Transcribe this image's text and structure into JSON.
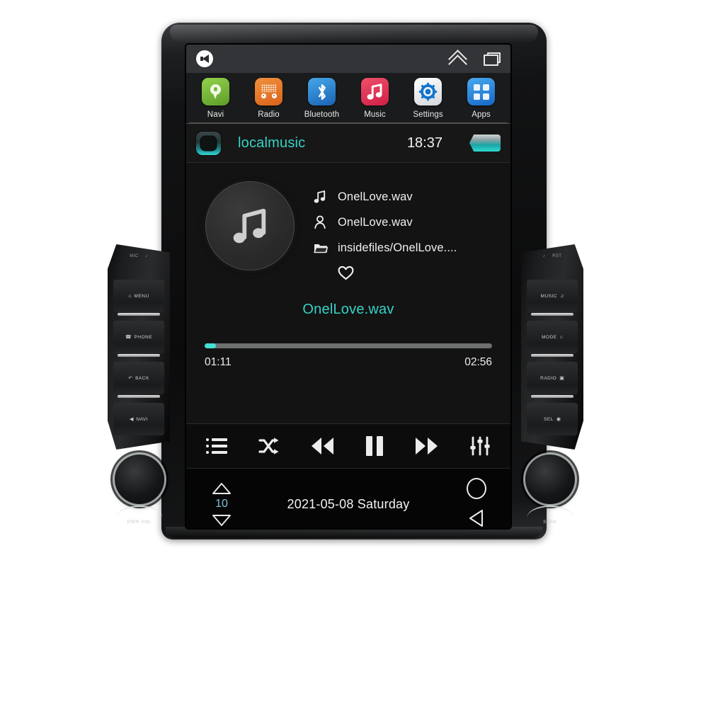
{
  "statusbar": {
    "speaker_icon": "speaker-icon",
    "expand_icon": "double-chevron-up-icon",
    "recents_icon": "recent-apps-icon"
  },
  "apps": [
    {
      "label": "Navi",
      "icon": "map-pin-icon",
      "color": "#7ec142"
    },
    {
      "label": "Radio",
      "icon": "radio-icon",
      "color": "#e5761f"
    },
    {
      "label": "Bluetooth",
      "icon": "bluetooth-icon",
      "color": "#2a86d8"
    },
    {
      "label": "Music",
      "icon": "music-note-icon",
      "color": "#e03256"
    },
    {
      "label": "Settings",
      "icon": "gear-icon",
      "color": "#ffffff"
    },
    {
      "label": "Apps",
      "icon": "grid-apps-icon",
      "color": "#2b86dd"
    }
  ],
  "titlebar": {
    "app_name": "localmusic",
    "time": "18:37",
    "left_icon": "rounded-square-icon",
    "right_icon": "battery-pill-icon",
    "accent": "#35d3c6"
  },
  "player": {
    "album_art_icon": "music-note-icon",
    "track_title": "OnelLove.wav",
    "artist": "OnelLove.wav",
    "folder": "insidefiles/OnelLove....",
    "favorite_icon": "heart-outline-icon",
    "now_playing": "OnelLove.wav",
    "elapsed": "01:11",
    "duration": "02:56",
    "progress_percent": 4,
    "progress_fill_color": "#45e0d4"
  },
  "controls": [
    {
      "name": "playlist-button",
      "icon": "list-icon"
    },
    {
      "name": "shuffle-button",
      "icon": "shuffle-icon"
    },
    {
      "name": "previous-button",
      "icon": "previous-track-icon"
    },
    {
      "name": "pause-button",
      "icon": "pause-icon"
    },
    {
      "name": "next-button",
      "icon": "next-track-icon"
    },
    {
      "name": "equalizer-button",
      "icon": "equalizer-icon"
    }
  ],
  "bottombar": {
    "volume_up_icon": "triangle-up-icon",
    "volume_level": "10",
    "volume_down_icon": "triangle-down-icon",
    "date": "2021-05-08  Saturday",
    "home_icon": "home-circle-icon",
    "back_icon": "back-triangle-icon",
    "volume_color": "#7fc3d8"
  },
  "hardware": {
    "left_panel": {
      "top_label_a": "MIC",
      "top_label_b": "♪",
      "buttons": [
        {
          "label": "MENU",
          "glyph": "⌂"
        },
        {
          "label": "PHONE",
          "glyph": "☎"
        },
        {
          "label": "BACK",
          "glyph": "↶"
        },
        {
          "label": "NAVI",
          "glyph": "◀"
        }
      ],
      "knob_label": "PWR VOL"
    },
    "right_panel": {
      "top_label_a": "♪",
      "top_label_b": "RST",
      "buttons": [
        {
          "label": "MUSIC",
          "glyph": "♫"
        },
        {
          "label": "MODE",
          "glyph": "⌂"
        },
        {
          "label": "RADIO",
          "glyph": "▣"
        },
        {
          "label": "SEL",
          "glyph": "◉"
        }
      ],
      "knob_label": "SEEK"
    }
  }
}
